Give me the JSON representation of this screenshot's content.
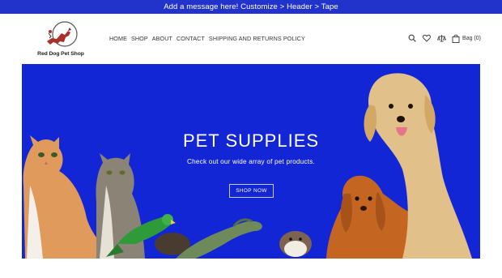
{
  "announcement": {
    "text": "Add a message here! Customize > Header > Tape"
  },
  "brand": {
    "name": "Red Dog Pet Shop"
  },
  "nav": {
    "items": [
      {
        "label": "HOME"
      },
      {
        "label": "SHOP"
      },
      {
        "label": "ABOUT"
      },
      {
        "label": "CONTACT"
      },
      {
        "label": "SHIPPING AND RETURNS POLICY"
      }
    ]
  },
  "header_icons": {
    "search": "search-icon",
    "wishlist": "heart-icon",
    "compare": "scale-icon",
    "bag_label": "Bag (0)"
  },
  "hero": {
    "title": "PET SUPPLIES",
    "subtitle": "Check out our wide array of pet products.",
    "button_label": "SHOP NOW",
    "background_color": "#1326d6"
  },
  "colors": {
    "tape": "#2233cc",
    "brand_red": "#a8322a"
  }
}
